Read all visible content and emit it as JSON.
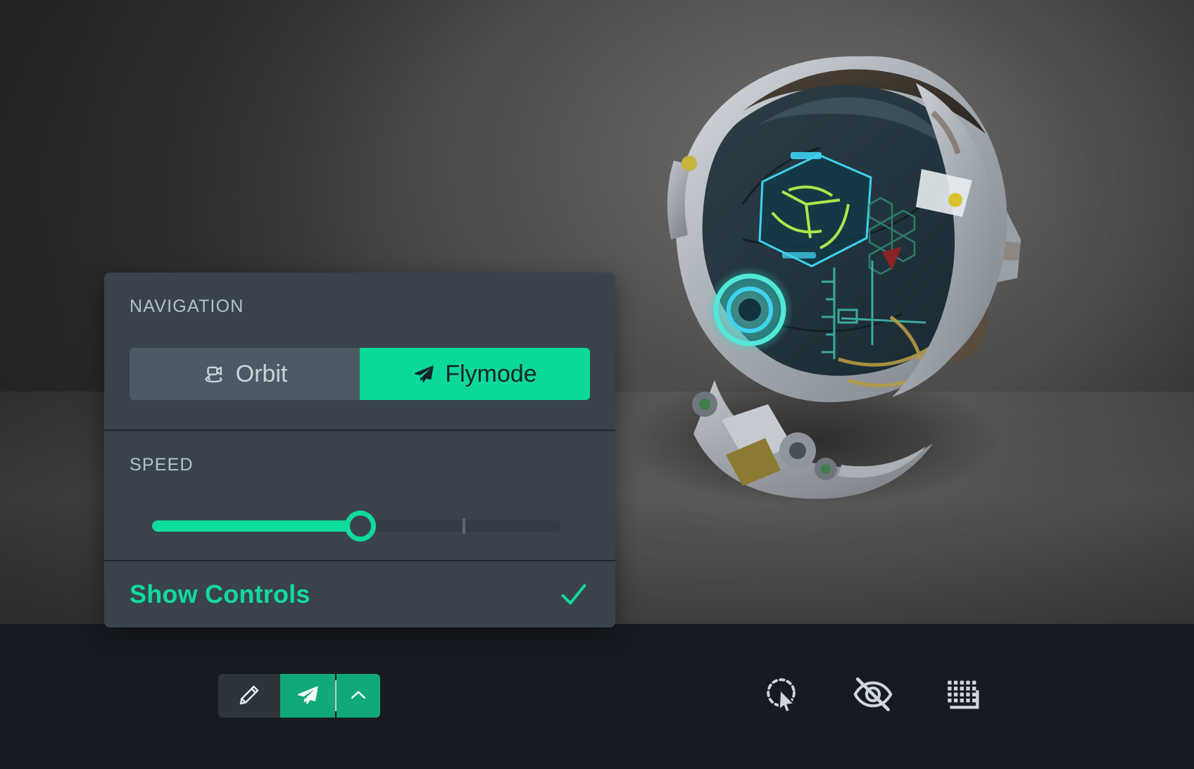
{
  "app": {
    "background_color": "#4a4a4a",
    "bottom_bar_color": "#171b21",
    "accent_color": "#0fdb9c",
    "panel_color": "#3a434c"
  },
  "viewport": {
    "model_name": "sci-fi-helmet-3d-model",
    "shadow": true
  },
  "nav_panel": {
    "navigation": {
      "label": "NAVIGATION",
      "options": [
        {
          "label": "Orbit",
          "icon": "orbit-camera-icon",
          "active": false
        },
        {
          "label": "Flymode",
          "icon": "paper-plane-icon",
          "active": true
        }
      ]
    },
    "speed": {
      "label": "SPEED",
      "value_percent": 51,
      "tick_percent": 76,
      "min": 0,
      "max": 100
    },
    "show_controls": {
      "label": "Show Controls",
      "checked": true,
      "check_icon": "checkmark-icon"
    }
  },
  "toolbar": {
    "buttons": [
      {
        "name": "edit-button",
        "icon": "pencil-icon",
        "active": false
      },
      {
        "name": "flymode-button",
        "icon": "paper-plane-icon",
        "active": true
      },
      {
        "name": "expand-options-button",
        "icon": "chevron-up-icon",
        "active": true
      }
    ]
  },
  "viewport_icons": [
    {
      "name": "selection-cursor-button",
      "icon": "dashed-circle-cursor-icon"
    },
    {
      "name": "hide-visibility-button",
      "icon": "eye-off-icon"
    },
    {
      "name": "grid-floor-button",
      "icon": "grid-floor-icon"
    }
  ]
}
